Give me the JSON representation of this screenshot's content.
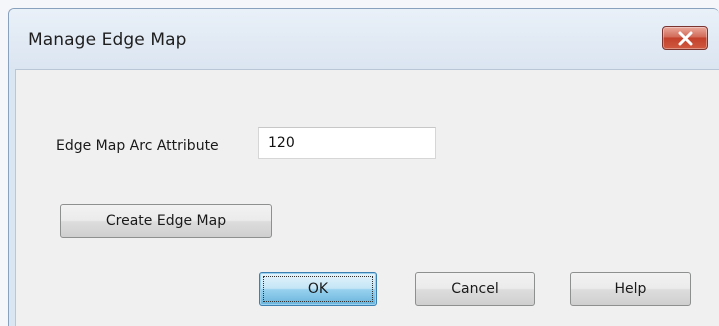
{
  "dialog": {
    "title": "Manage Edge Map",
    "close_icon": "close-x-icon"
  },
  "form": {
    "edge_map_arc_attribute_label": "Edge Map Arc Attribute",
    "edge_map_arc_attribute_value": "120"
  },
  "buttons": {
    "create_edge_map": "Create Edge Map",
    "ok": "OK",
    "cancel": "Cancel",
    "help": "Help"
  },
  "colors": {
    "close_button": "#c2412c",
    "default_button_accent": "#3c7fb1"
  }
}
